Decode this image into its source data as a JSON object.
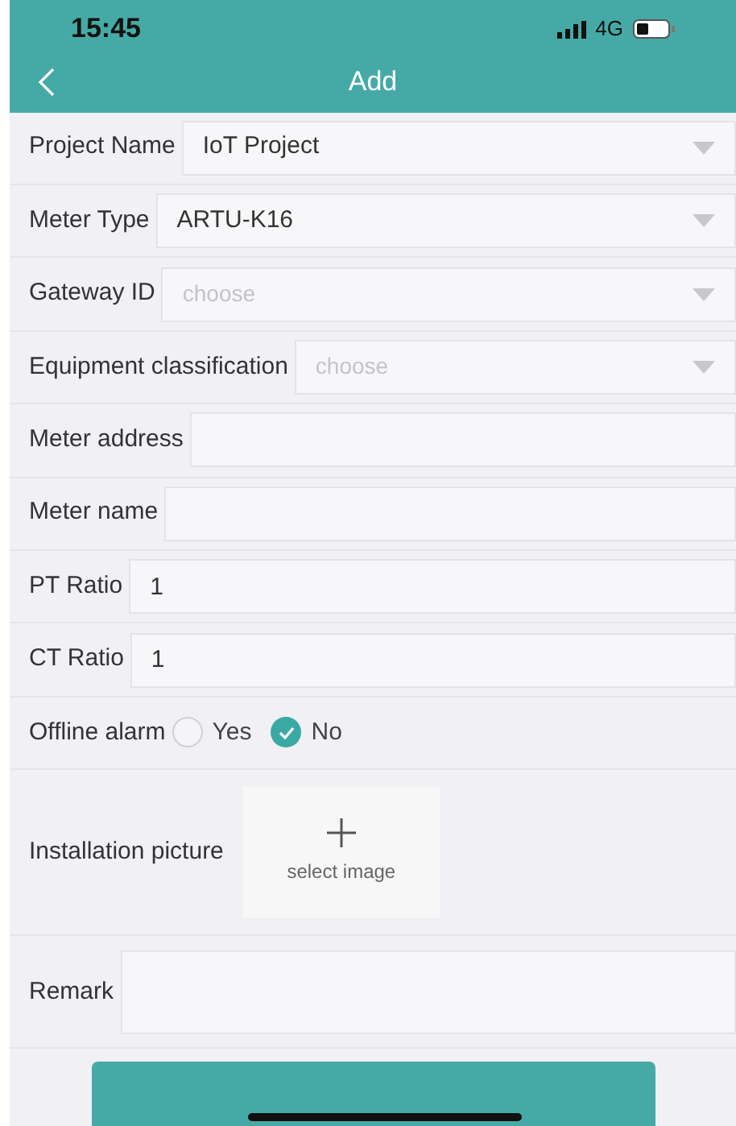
{
  "status_bar": {
    "time": "15:45",
    "network": "4G"
  },
  "nav": {
    "title": "Add"
  },
  "fields": [
    {
      "kind": "select",
      "label": "Project Name",
      "value": "IoT Project"
    },
    {
      "kind": "select",
      "label": "Meter Type",
      "value": "ARTU-K16"
    },
    {
      "kind": "select",
      "label": "Gateway ID",
      "placeholder": "choose"
    },
    {
      "kind": "select",
      "label": "Equipment classification",
      "placeholder": "choose"
    },
    {
      "kind": "input",
      "label": "Meter address"
    },
    {
      "kind": "input",
      "label": "Meter name"
    },
    {
      "kind": "input",
      "label": "PT Ratio",
      "value": "1"
    },
    {
      "kind": "input",
      "label": "CT Ratio",
      "value": "1"
    },
    {
      "kind": "radio",
      "label": "Offline alarm",
      "options": [
        {
          "label": "Yes",
          "selected": false
        },
        {
          "label": "No",
          "selected": true
        }
      ]
    },
    {
      "kind": "image",
      "label": "Installation picture",
      "button": "select image"
    },
    {
      "kind": "textarea",
      "label": "Remark"
    }
  ]
}
